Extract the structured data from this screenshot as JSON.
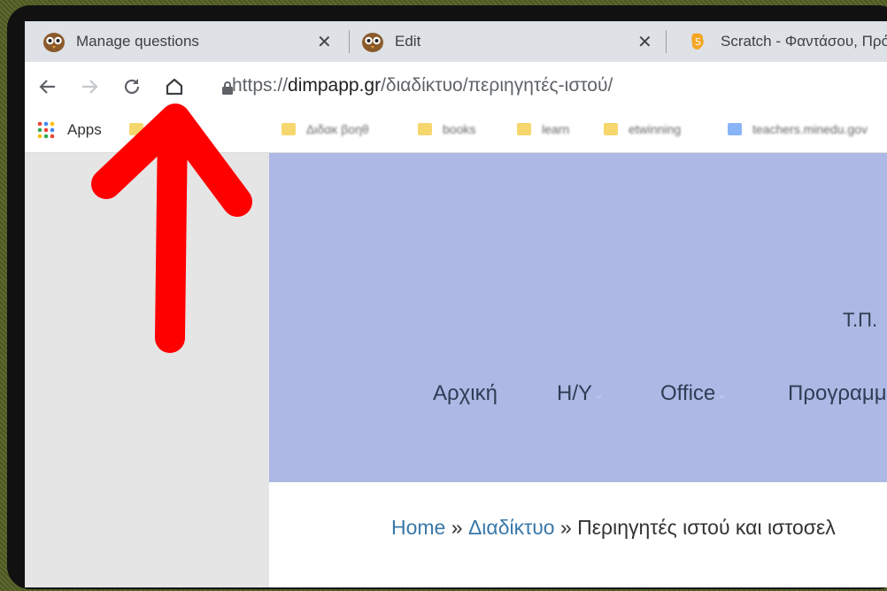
{
  "tabs": [
    {
      "title": "Manage questions",
      "close": "✕"
    },
    {
      "title": "Edit",
      "close": "✕"
    },
    {
      "title": "Scratch - Φαντάσου, Πρό"
    }
  ],
  "toolbar": {
    "url_scheme": "https://",
    "url_host": "dimpapp.gr",
    "url_path": "/διαδίκτυο/περιηγητές-ιστού/"
  },
  "icons": {
    "back": "back-arrow-icon",
    "forward": "forward-arrow-icon",
    "reload": "reload-icon",
    "home": "home-icon",
    "lock": "lock-icon",
    "apps": "apps-grid-icon"
  },
  "bookmarks": [
    {
      "label": "Apps"
    },
    {
      "label": "2.0 tools"
    },
    {
      "label": "Διδακ βοηθ"
    },
    {
      "label": "books"
    },
    {
      "label": "learn"
    },
    {
      "label": "etwinning"
    },
    {
      "label": "teachers.minedu.gov"
    }
  ],
  "site": {
    "header_text": "Τ.Π.",
    "menu": [
      {
        "label": "Αρχική"
      },
      {
        "label": "Η/Υ"
      },
      {
        "label": "Office"
      },
      {
        "label": "Προγραμμ"
      }
    ],
    "breadcrumb": {
      "home": "Home",
      "sep1": "»",
      "section": "Διαδίκτυο",
      "sep2": "»",
      "current": "Περιηγητές ιστού και ιστοσελ"
    }
  },
  "colors": {
    "annotation_arrow": "#ff0000",
    "header_bg": "#aeb8e4"
  }
}
